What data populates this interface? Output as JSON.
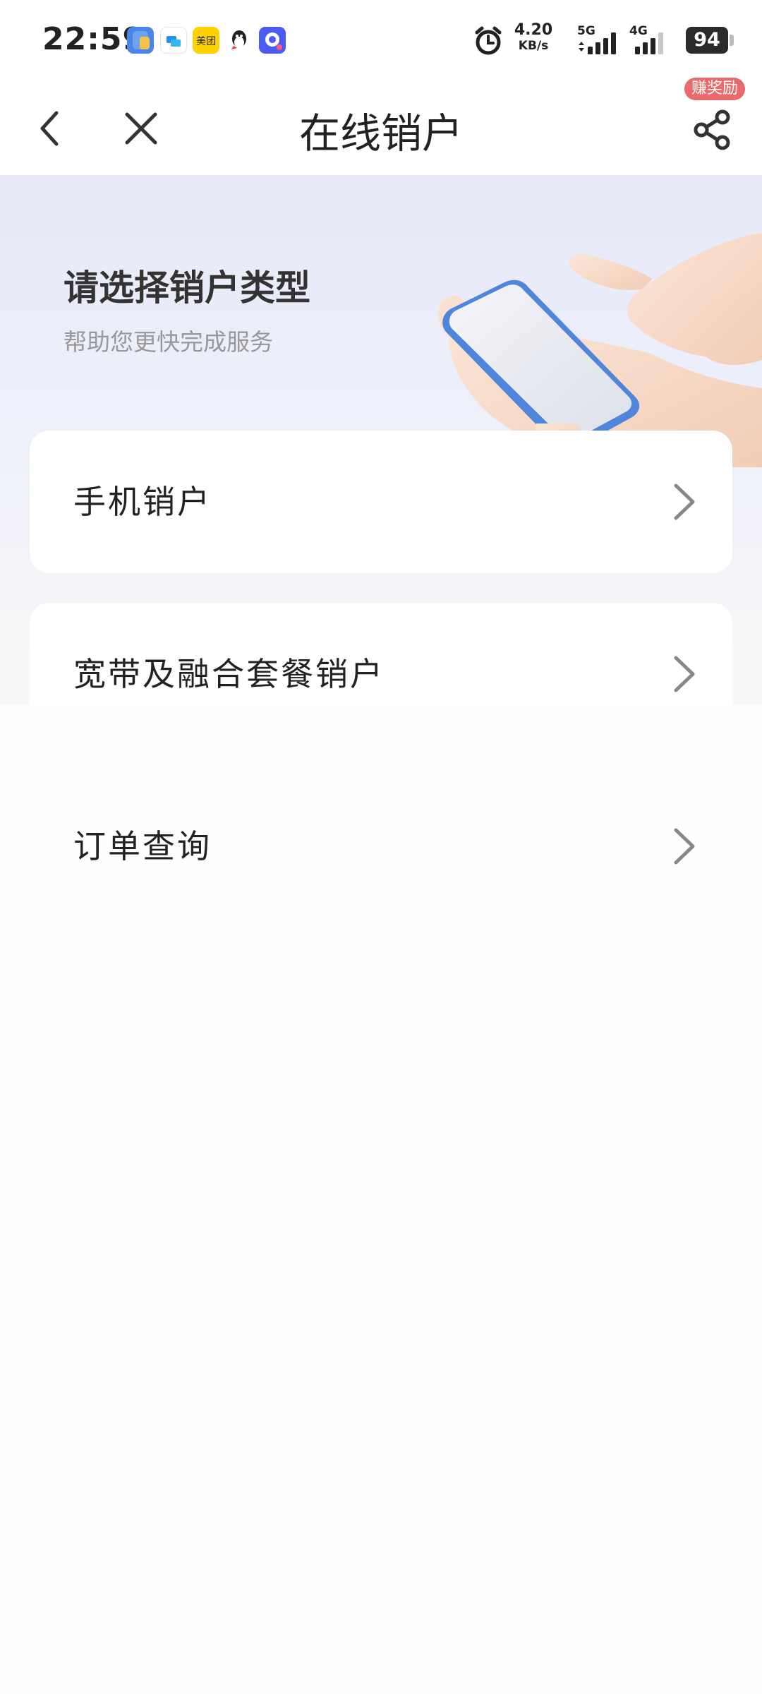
{
  "status_bar": {
    "time": "22:59",
    "net_speed_value": "4.20",
    "net_speed_unit": "KB/s",
    "sim1_label": "5G",
    "sim2_label": "4G",
    "battery": "94",
    "app_icons": [
      "files-app-icon",
      "chat-app-icon",
      "meituan-app-icon",
      "qq-app-icon",
      "messenger-app-icon"
    ]
  },
  "header": {
    "title": "在线销户",
    "reward_badge": "赚奖励"
  },
  "banner": {
    "title": "请选择销户类型",
    "subtitle": "帮助您更快完成服务"
  },
  "menu": {
    "items": [
      {
        "label": "手机销户"
      },
      {
        "label": "宽带及融合套餐销户"
      },
      {
        "label": "订单查询"
      }
    ]
  },
  "colors": {
    "accent_badge": "#e86a6a",
    "banner_bg": "#e7e9f8",
    "phone_blue": "#4f86db"
  }
}
